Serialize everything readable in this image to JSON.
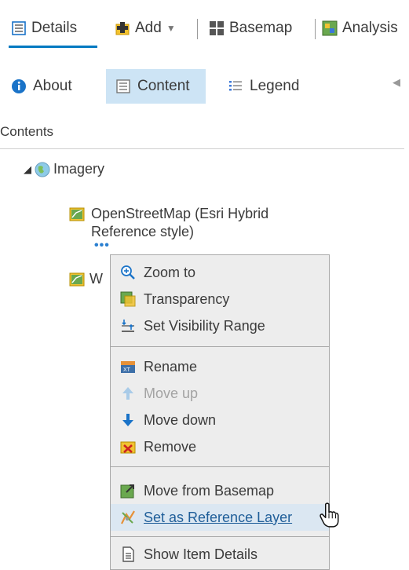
{
  "toolbar": {
    "details": "Details",
    "add": "Add",
    "basemap": "Basemap",
    "analysis": "Analysis"
  },
  "tabs": {
    "about": "About",
    "content": "Content",
    "legend": "Legend"
  },
  "panel": {
    "contents_label": "Contents"
  },
  "tree": {
    "group": "Imagery",
    "layer1_line1": "OpenStreetMap (Esri Hybrid",
    "layer1_line2": "Reference style)",
    "layer2_partial": "W"
  },
  "context_menu": {
    "items": [
      {
        "label": "Zoom to",
        "icon": "zoom-icon",
        "enabled": true
      },
      {
        "label": "Transparency",
        "icon": "transparency-icon",
        "enabled": true
      },
      {
        "label": "Set Visibility Range",
        "icon": "visibility-range-icon",
        "enabled": true
      },
      {
        "label": "Rename",
        "icon": "rename-icon",
        "enabled": true
      },
      {
        "label": "Move up",
        "icon": "arrow-up-icon",
        "enabled": false
      },
      {
        "label": "Move down",
        "icon": "arrow-down-icon",
        "enabled": true
      },
      {
        "label": "Remove",
        "icon": "remove-icon",
        "enabled": true
      },
      {
        "label": "Move from Basemap",
        "icon": "move-from-basemap-icon",
        "enabled": true
      },
      {
        "label": "Set as Reference Layer",
        "icon": "reference-layer-icon",
        "enabled": true,
        "hovered": true
      },
      {
        "label": "Show Item Details",
        "icon": "item-details-icon",
        "enabled": true
      }
    ]
  },
  "colors": {
    "accent": "#0079c1",
    "active_tab_bg": "#cde4f5",
    "menu_bg": "#ededed",
    "menu_hover_bg": "#dbe7f2"
  }
}
